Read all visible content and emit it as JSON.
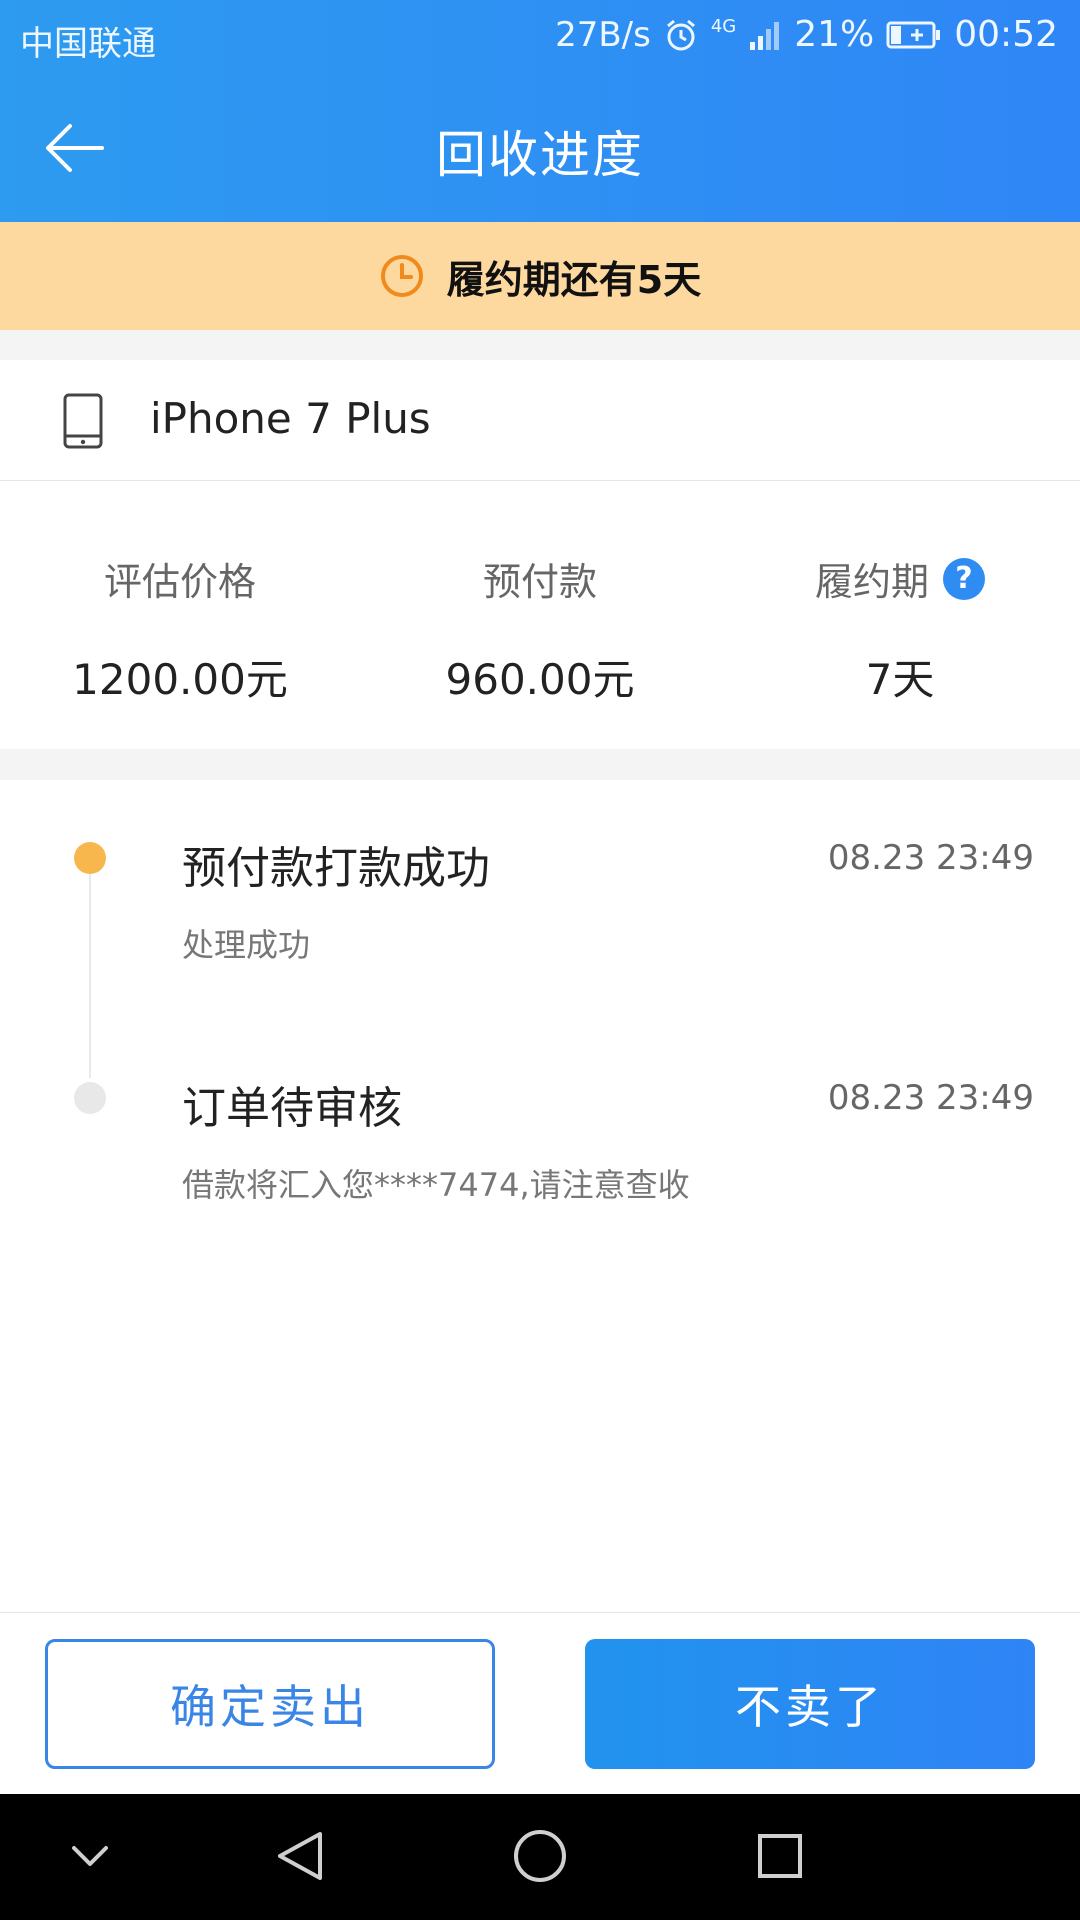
{
  "status_bar": {
    "carrier": "中国联通",
    "net_speed": "27B/s",
    "network": "4G",
    "battery": "21%",
    "time": "00:52"
  },
  "header": {
    "title": "回收进度"
  },
  "notice": {
    "text": "履约期还有5天",
    "color": "#fdd9a0"
  },
  "device": {
    "name": "iPhone 7 Plus"
  },
  "stats": [
    {
      "label": "评估价格",
      "value": "1200.00元"
    },
    {
      "label": "预付款",
      "value": "960.00元"
    },
    {
      "label": "履约期",
      "value": "7天"
    }
  ],
  "timeline": [
    {
      "title": "预付款打款成功",
      "time": "08.23 23:49",
      "desc": "处理成功",
      "dot_color": "#f8b74d"
    },
    {
      "title": "订单待审核",
      "time": "08.23 23:49",
      "desc": "借款将汇入您****7474,请注意查收",
      "dot_color": "#e8e8e8"
    }
  ],
  "actions": {
    "confirm_label": "确定卖出",
    "cancel_label": "不卖了"
  },
  "colors": {
    "primary": "#2f86f6",
    "accent_orange": "#f08a1c"
  },
  "icons": {
    "help": "?"
  }
}
